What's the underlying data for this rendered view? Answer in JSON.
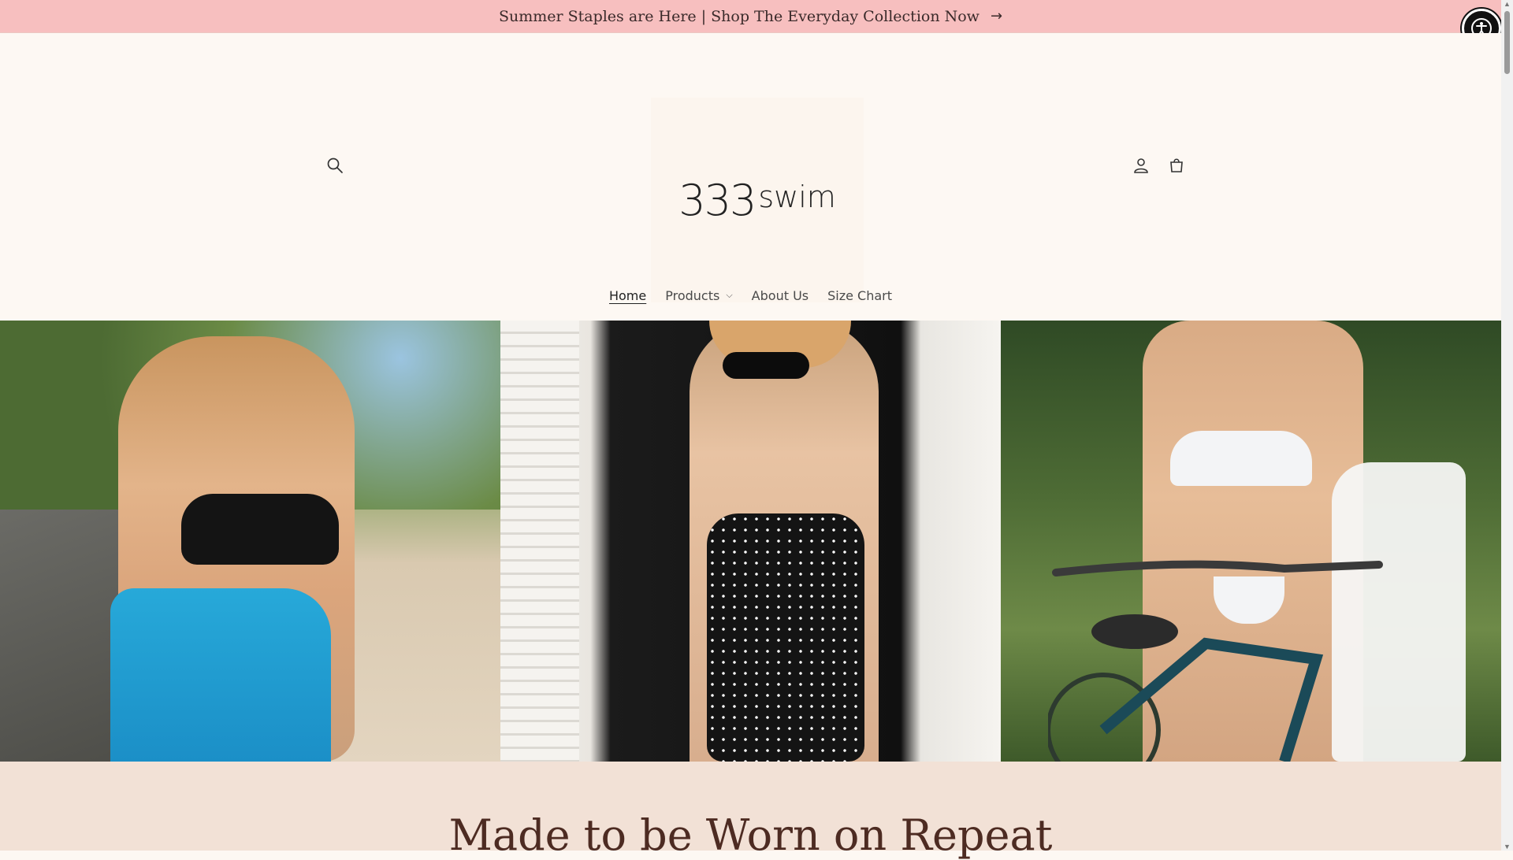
{
  "announcement": {
    "text": "Summer Staples are Here | Shop The Everyday Collection Now",
    "arrow": "→"
  },
  "brand": {
    "digits": "333",
    "word": "swim"
  },
  "nav": {
    "items": [
      {
        "label": "Home",
        "active": true
      },
      {
        "label": "Products",
        "dropdown": true
      },
      {
        "label": "About Us"
      },
      {
        "label": "Size Chart"
      }
    ]
  },
  "icons": {
    "search": "search-icon",
    "account": "account-icon",
    "cart": "cart-icon",
    "accessibility": "accessibility-icon"
  },
  "intro": {
    "heading": "Made to be Worn on Repeat"
  },
  "colors": {
    "announcement_bg": "#f7bfbf",
    "page_bg": "#fdf8f3",
    "intro_bg": "#f2e1d6",
    "heading": "#4d2b22"
  }
}
